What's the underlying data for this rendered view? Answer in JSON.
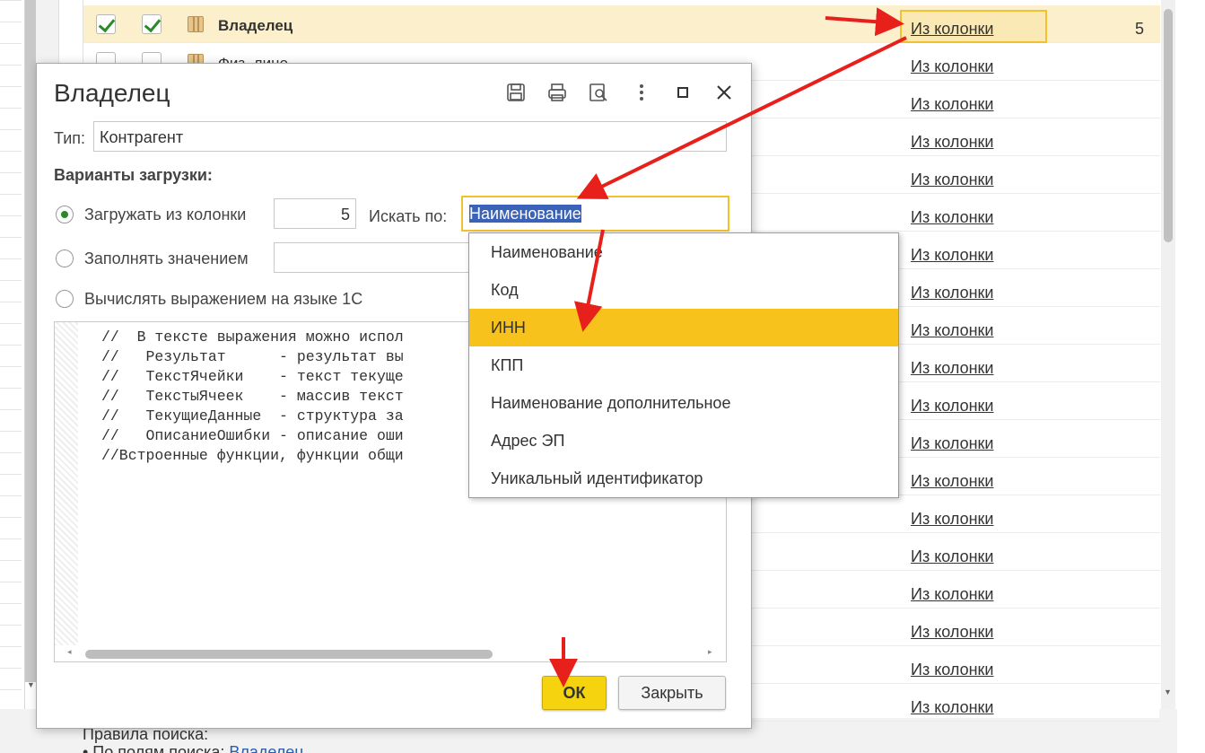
{
  "table": {
    "rows": [
      {
        "name": "Владелец",
        "link": "Из колонки",
        "num": "5",
        "checked1": true,
        "checked2": true,
        "selected": true
      },
      {
        "name": "Физ. лицо",
        "link": "Из колонки",
        "num": "",
        "checked1": false,
        "checked2": false,
        "selected": false
      },
      {
        "link": "Из колонки"
      },
      {
        "link": "Из колонки"
      },
      {
        "link": "Из колонки"
      },
      {
        "link": "Из колонки"
      },
      {
        "link": "Из колонки"
      },
      {
        "link": "Из колонки"
      },
      {
        "link": "Из колонки"
      },
      {
        "link": "Из колонки"
      },
      {
        "link": "Из колонки"
      },
      {
        "link": "Из колонки"
      },
      {
        "link": "Из колонки"
      },
      {
        "link": "Из колонки"
      },
      {
        "link": "Из колонки"
      },
      {
        "link": "Из колонки"
      },
      {
        "link": "Из колонки"
      },
      {
        "link": "Из колонки"
      },
      {
        "link": "Из колонки"
      }
    ]
  },
  "bottom": {
    "line1": "Правила поиска:",
    "line2_prefix": "• По полям поиска: ",
    "line2_link": "Владелец"
  },
  "dialog": {
    "title": "Владелец",
    "toolbar": {
      "save_icon": "save-icon",
      "print_icon": "print-icon",
      "preview_icon": "preview-icon",
      "more_icon": "more-icon",
      "maximize_icon": "maximize-icon",
      "close_icon": "close-icon"
    },
    "type_label": "Тип:",
    "type_value": "Контрагент",
    "section_title": "Варианты загрузки:",
    "options": {
      "from_column": "Загружать из колонки",
      "fill_value": "Заполнять значением",
      "compute_expr": "Вычислять выражением на языке 1С"
    },
    "column_number": "5",
    "search_by_label": "Искать по:",
    "search_by_value": "Наименование",
    "code_lines": [
      "//  В тексте выражения можно испол",
      "//   Результат      - результат вы",
      "//   ТекстЯчейки    - текст текуще",
      "//   ТекстыЯчеек    - массив текст",
      "//   ТекущиеДанные  - структура за",
      "//   ОписаниеОшибки - описание оши",
      "//Встроенные функции, функции общи"
    ],
    "ok_label": "ОК",
    "close_label": "Закрыть"
  },
  "dropdown": {
    "items": [
      "Наименование",
      "Код",
      "ИНН",
      "КПП",
      "Наименование дополнительное",
      "Адрес ЭП",
      "Уникальный идентификатор"
    ],
    "active_index": 2
  },
  "colors": {
    "accent_yellow": "#f7c21b",
    "selection_blue": "#3a62b8",
    "arrow_red": "#e8201c"
  }
}
